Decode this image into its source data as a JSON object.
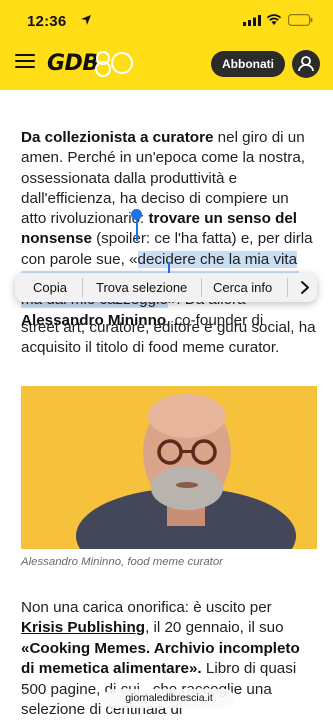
{
  "status_bar": {
    "time": "12:36"
  },
  "header": {
    "logo": "GDB",
    "subscribe_label": "Abbonati"
  },
  "article": {
    "p1": {
      "b1": "Da collezionista a curatore",
      "t1": " nel giro di un amen. Perché in un'epoca come la nostra, ossessionata dalla produttività e dall'efficienza, ha deciso di compiere un atto rivoluzionario: ",
      "b2": "trovare un senso del nonsense",
      "t2": " (spoiler: ce l'ha fatta) e, per dirla con parole sue, «",
      "selected": "decidere che la mia vita non sarebbe stata definita dal mio lavoro, ma dal mio cazzeggio",
      "t3": "». Da allora ",
      "b3": "Alessandro Mininno",
      "t4": ", co-founder di"
    },
    "p2_visible": "street art, curatore, editore e guru social, ha acquisito il titolo di food meme curator.",
    "photo_caption": "Alessandro Mininno, food meme curator",
    "p3": {
      "t1": "Non una carica onorifica: è uscito per ",
      "link": "Krisis Publishing",
      "t2": ", il 20 gennaio, il suo ",
      "b1": "«Cooking Memes. Archivio incompleto di memetica alimentare».",
      "t3": " Libro di quasi 500 pagine, di cui ",
      "t4": ", che raccoglie una selezione di centinaia di"
    }
  },
  "context_menu": {
    "items": [
      "Copia",
      "Trova selezione",
      "Cerca info"
    ]
  },
  "browser": {
    "url": "giornaledibrescia.it"
  },
  "colors": {
    "brand_yellow": "#ffde17",
    "selection": "#c9ddf3",
    "handle": "#1a73e8"
  }
}
